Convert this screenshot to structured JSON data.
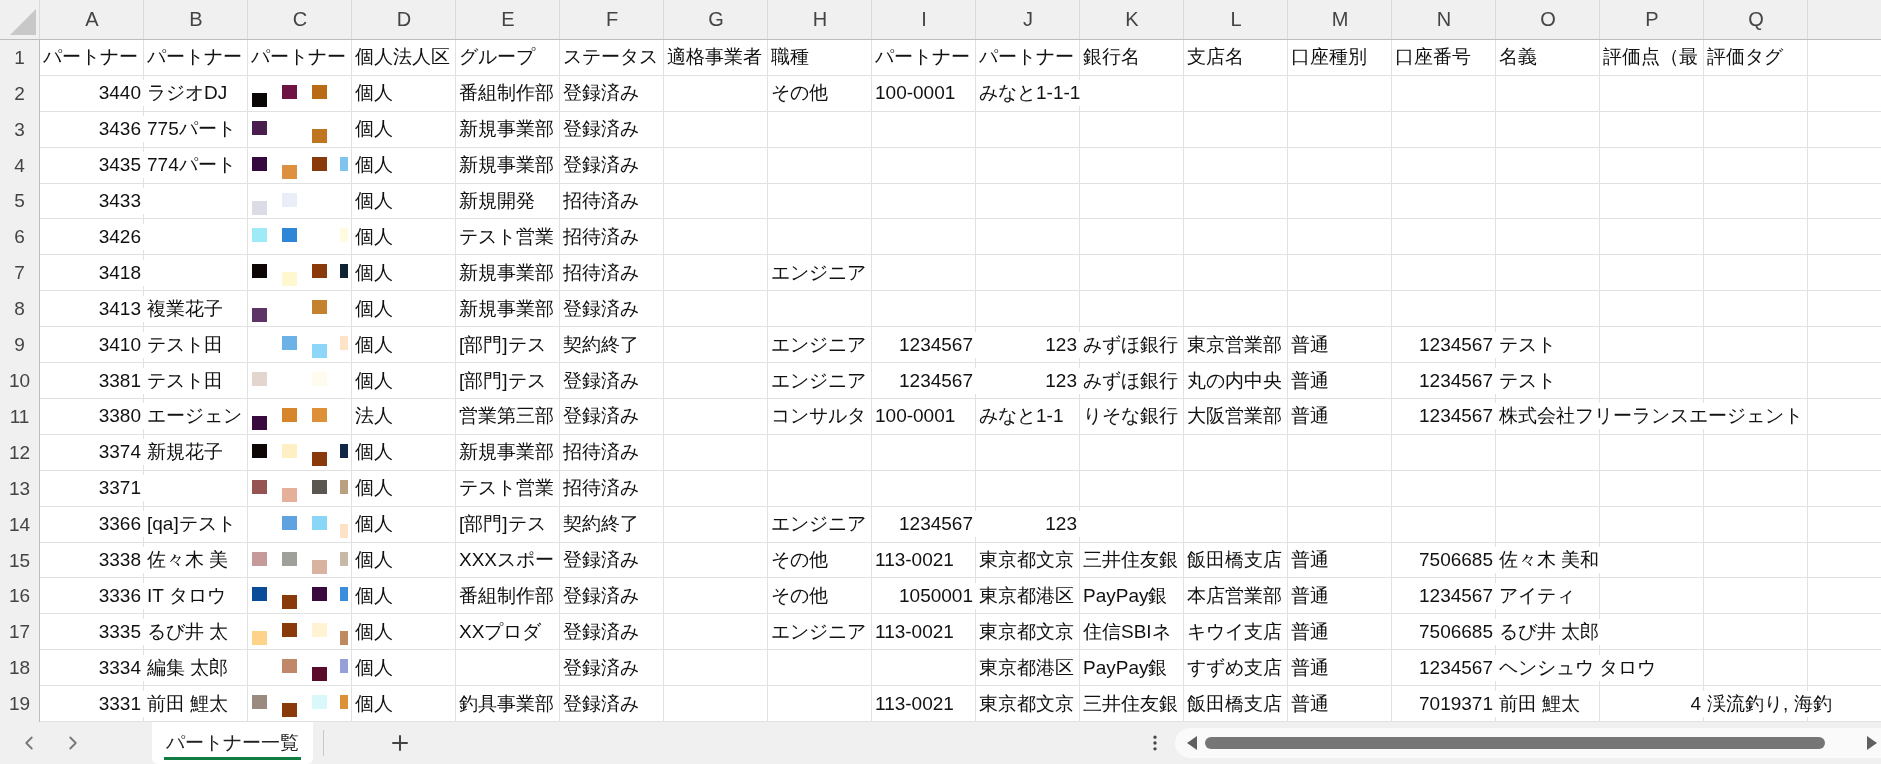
{
  "sheet": {
    "column_letters": [
      "A",
      "B",
      "C",
      "D",
      "E",
      "F",
      "G",
      "H",
      "I",
      "J",
      "K",
      "L",
      "M",
      "N",
      "O",
      "P",
      "Q"
    ],
    "header_row": {
      "number": "1",
      "cells": [
        "パートナー",
        "パートナー",
        "パートナー",
        "個人法人区",
        "グループ",
        "ステータス",
        "適格事業者",
        "職種",
        "パートナー",
        "パートナー",
        "銀行名",
        "支店名",
        "口座種別",
        "口座番号",
        "名義",
        "評価点（最",
        "評価タグ"
      ]
    },
    "rows": [
      {
        "number": "2",
        "cells": [
          {
            "kind": "number",
            "text": "3440"
          },
          "ラジオDJ",
          {
            "kind": "redacted"
          },
          "個人",
          "番組制作部",
          "登録済み",
          null,
          "その他",
          "100-0001",
          "みなと1-1-1",
          null,
          null,
          null,
          null,
          null,
          null,
          null
        ]
      },
      {
        "number": "3",
        "cells": [
          {
            "kind": "number",
            "text": "3436"
          },
          "775パート",
          {
            "kind": "redacted"
          },
          "個人",
          "新規事業部",
          "登録済み",
          null,
          null,
          null,
          null,
          null,
          null,
          null,
          null,
          null,
          null,
          null
        ]
      },
      {
        "number": "4",
        "cells": [
          {
            "kind": "number",
            "text": "3435"
          },
          "774パート",
          {
            "kind": "redacted"
          },
          "個人",
          "新規事業部",
          "登録済み",
          null,
          null,
          null,
          null,
          null,
          null,
          null,
          null,
          null,
          null,
          null
        ]
      },
      {
        "number": "5",
        "cells": [
          {
            "kind": "number",
            "text": "3433"
          },
          null,
          {
            "kind": "redacted"
          },
          "個人",
          "新規開発",
          "招待済み",
          null,
          null,
          null,
          null,
          null,
          null,
          null,
          null,
          null,
          null,
          null
        ]
      },
      {
        "number": "6",
        "cells": [
          {
            "kind": "number",
            "text": "3426"
          },
          null,
          {
            "kind": "redacted"
          },
          "個人",
          "テスト営業",
          "招待済み",
          null,
          null,
          null,
          null,
          null,
          null,
          null,
          null,
          null,
          null,
          null
        ]
      },
      {
        "number": "7",
        "cells": [
          {
            "kind": "number",
            "text": "3418"
          },
          null,
          {
            "kind": "redacted"
          },
          "個人",
          "新規事業部",
          "招待済み",
          null,
          "エンジニア",
          null,
          null,
          null,
          null,
          null,
          null,
          null,
          null,
          null
        ]
      },
      {
        "number": "8",
        "cells": [
          {
            "kind": "number",
            "text": "3413"
          },
          "複業花子",
          {
            "kind": "redacted"
          },
          "個人",
          "新規事業部",
          "登録済み",
          null,
          null,
          null,
          null,
          null,
          null,
          null,
          null,
          null,
          null,
          null
        ]
      },
      {
        "number": "9",
        "cells": [
          {
            "kind": "number",
            "text": "3410"
          },
          "テスト田",
          {
            "kind": "redacted"
          },
          "個人",
          "[部門]テス",
          "契約終了",
          null,
          "エンジニア",
          {
            "kind": "number",
            "text": "1234567"
          },
          {
            "kind": "number",
            "text": "123"
          },
          "みずほ銀行",
          "東京営業部",
          "普通",
          {
            "kind": "number",
            "text": "1234567"
          },
          "テスト",
          null,
          null
        ]
      },
      {
        "number": "10",
        "cells": [
          {
            "kind": "number",
            "text": "3381"
          },
          "テスト田",
          {
            "kind": "redacted"
          },
          "個人",
          "[部門]テス",
          "登録済み",
          null,
          "エンジニア",
          {
            "kind": "number",
            "text": "1234567"
          },
          {
            "kind": "number",
            "text": "123"
          },
          "みずほ銀行",
          "丸の内中央",
          "普通",
          {
            "kind": "number",
            "text": "1234567"
          },
          "テスト",
          null,
          null
        ]
      },
      {
        "number": "11",
        "cells": [
          {
            "kind": "number",
            "text": "3380"
          },
          "エージェン",
          {
            "kind": "redacted"
          },
          "法人",
          "営業第三部",
          "登録済み",
          null,
          "コンサルタ",
          "100-0001",
          "みなと1-1",
          "りそな銀行",
          "大阪営業部",
          "普通",
          {
            "kind": "number",
            "text": "1234567"
          },
          "株式会社フリーランスエージェント",
          null,
          null
        ]
      },
      {
        "number": "12",
        "cells": [
          {
            "kind": "number",
            "text": "3374"
          },
          "新規花子",
          {
            "kind": "redacted"
          },
          "個人",
          "新規事業部",
          "招待済み",
          null,
          null,
          null,
          null,
          null,
          null,
          null,
          null,
          null,
          null,
          null
        ]
      },
      {
        "number": "13",
        "cells": [
          {
            "kind": "number",
            "text": "3371"
          },
          null,
          {
            "kind": "redacted"
          },
          "個人",
          "テスト営業",
          "招待済み",
          null,
          null,
          null,
          null,
          null,
          null,
          null,
          null,
          null,
          null,
          null
        ]
      },
      {
        "number": "14",
        "cells": [
          {
            "kind": "number",
            "text": "3366"
          },
          "[qa]テスト",
          {
            "kind": "redacted"
          },
          "個人",
          "[部門]テス",
          "契約終了",
          null,
          "エンジニア",
          {
            "kind": "number",
            "text": "1234567"
          },
          {
            "kind": "number",
            "text": "123"
          },
          null,
          null,
          null,
          null,
          null,
          null,
          null
        ]
      },
      {
        "number": "15",
        "cells": [
          {
            "kind": "number",
            "text": "3338"
          },
          "佐々木 美",
          {
            "kind": "redacted"
          },
          "個人",
          "XXXスポー",
          "登録済み",
          null,
          "その他",
          "113-0021",
          "東京都文京",
          "三井住友銀",
          "飯田橋支店",
          "普通",
          {
            "kind": "number",
            "text": "7506685"
          },
          "佐々木 美和",
          null,
          null
        ]
      },
      {
        "number": "16",
        "cells": [
          {
            "kind": "number",
            "text": "3336"
          },
          "IT タロウ",
          {
            "kind": "redacted"
          },
          "個人",
          "番組制作部",
          "登録済み",
          null,
          "その他",
          {
            "kind": "number",
            "text": "1050001"
          },
          "東京都港区",
          "PayPay銀",
          "本店営業部",
          "普通",
          {
            "kind": "number",
            "text": "1234567"
          },
          "アイティ",
          null,
          null
        ]
      },
      {
        "number": "17",
        "cells": [
          {
            "kind": "number",
            "text": "3335"
          },
          "るび井 太",
          {
            "kind": "redacted"
          },
          "個人",
          "XXプロダ",
          "登録済み",
          null,
          "エンジニア",
          "113-0021",
          "東京都文京",
          "住信SBIネ",
          "キウイ支店",
          "普通",
          {
            "kind": "number",
            "text": "7506685"
          },
          "るび井 太郎",
          null,
          null
        ]
      },
      {
        "number": "18",
        "cells": [
          {
            "kind": "number",
            "text": "3334"
          },
          "編集 太郎",
          {
            "kind": "redacted"
          },
          "個人",
          null,
          "登録済み",
          null,
          null,
          null,
          "東京都港区",
          "PayPay銀",
          "すずめ支店",
          "普通",
          {
            "kind": "number",
            "text": "1234567"
          },
          "ヘンシュウ タロウ",
          null,
          null
        ]
      },
      {
        "number": "19",
        "cells": [
          {
            "kind": "number",
            "text": "3331"
          },
          "前田 鯉太",
          {
            "kind": "redacted"
          },
          "個人",
          "釣具事業部",
          "登録済み",
          null,
          null,
          "113-0021",
          "東京都文京",
          "三井住友銀",
          "飯田橋支店",
          "普通",
          {
            "kind": "number",
            "text": "7019371"
          },
          "前田 鯉太",
          {
            "kind": "number",
            "text": "4"
          },
          "渓流釣り, 海釣"
        ]
      }
    ]
  },
  "sheet_tabs": [
    {
      "label": "パートナー一覧",
      "selected": true
    }
  ]
}
